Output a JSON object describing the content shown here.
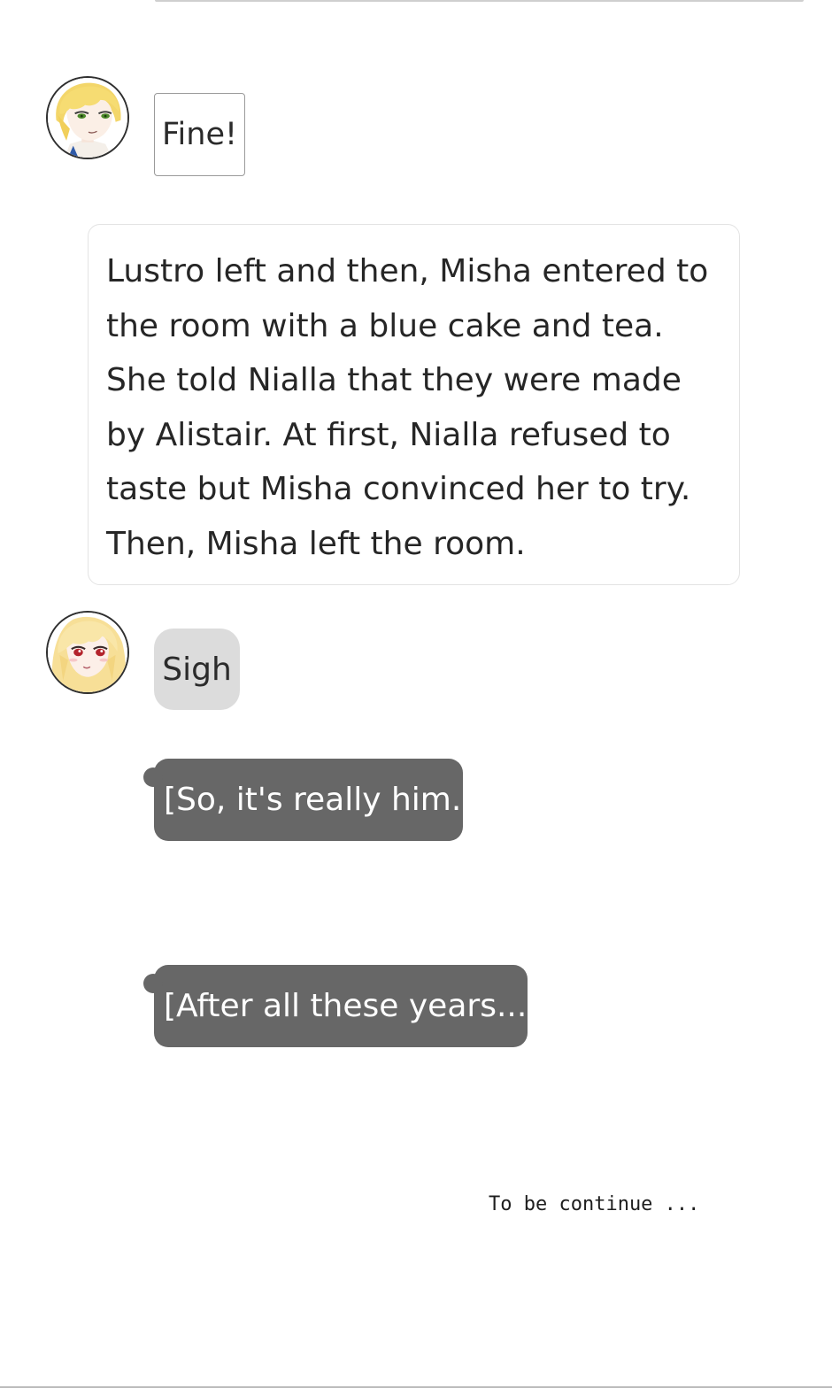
{
  "messages": {
    "lustro_line": "Fine!",
    "narration": "Lustro left and then, Misha entered to the room with a blue cake and tea. She told Nialla that they were made by Alistair. At first, Nialla refused to taste but Misha convinced her to try. Then, Misha left the room.",
    "nialla_line": "Sigh",
    "thought_1": "[So, it's really him.]",
    "thought_2": "[After all these years...]"
  },
  "footer": {
    "to_be_continued": "To be continue ..."
  },
  "colors": {
    "thought_bubble": "#676767",
    "sigh_bubble": "#dcdcdc",
    "narration_border": "#e3e3e3",
    "lustro_hair": "#f3d66a",
    "lustro_eyes": "#4c8a2a",
    "nialla_hair": "#f7df97",
    "nialla_eyes": "#b3242c"
  },
  "icons": {
    "lustro_avatar": "blonde-man-portrait-icon",
    "nialla_avatar": "blonde-woman-portrait-icon"
  }
}
